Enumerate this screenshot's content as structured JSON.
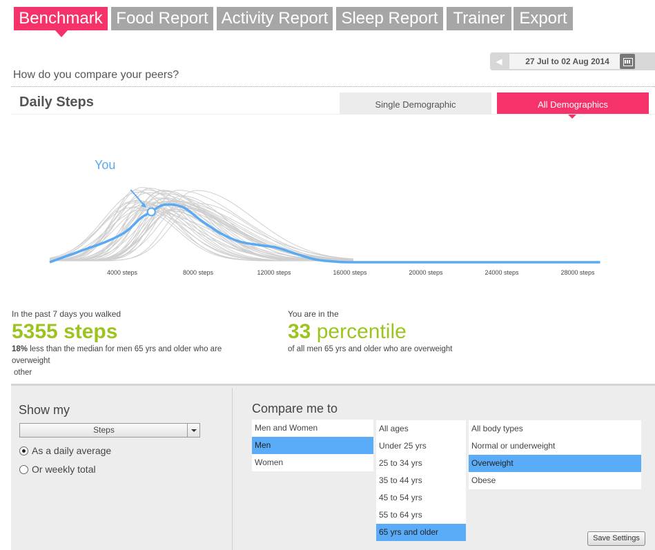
{
  "tabs": [
    {
      "label": "Benchmark",
      "active": true
    },
    {
      "label": "Food Report",
      "active": false
    },
    {
      "label": "Activity Report",
      "active": false
    },
    {
      "label": "Sleep Report",
      "active": false
    },
    {
      "label": "Trainer",
      "active": false
    },
    {
      "label": "Export",
      "active": false
    }
  ],
  "date_range": "27 Jul to 02 Aug 2014",
  "subtitle": "How do you compare your peers?",
  "section_title": "Daily Steps",
  "view_toggle": {
    "single": "Single Demographic",
    "all": "All Demographics",
    "selected": "all"
  },
  "you_label": "You",
  "colors": {
    "accent": "#f5336a",
    "highlight": "#5aabf8",
    "green": "#9dc31f",
    "tab_gray": "#a6a6a6"
  },
  "chart_data": {
    "type": "line",
    "x_ticks": [
      "4000 steps",
      "8000 steps",
      "12000 steps",
      "16000 steps",
      "20000 steps",
      "24000 steps",
      "28000 steps"
    ],
    "series": [
      {
        "name": "You",
        "x": [
          0,
          2000,
          3000,
          4000,
          4800,
          5355,
          6000,
          7000,
          8000,
          9000,
          10000,
          11000,
          12000,
          13000,
          14000,
          15000,
          16000,
          20000,
          24000,
          28000,
          29000
        ],
        "y": [
          0.0,
          0.2,
          0.3,
          0.44,
          0.64,
          0.73,
          0.83,
          0.8,
          0.6,
          0.42,
          0.3,
          0.25,
          0.21,
          0.12,
          0.04,
          0.01,
          0.0,
          0.0,
          0.0,
          0.0,
          0.0
        ]
      }
    ],
    "you_marker_x": 5355,
    "grid": false
  },
  "stats": {
    "steps_lead": "In the past 7 days you walked",
    "steps_value": "5355 steps",
    "steps_pct": "18%",
    "steps_desc": "less than the median for men 65 yrs and older who are overweight",
    "steps_other": "other",
    "pct_lead": "You are in the",
    "pct_number": "33",
    "pct_word": "percentile",
    "pct_desc": "of all men 65 yrs and older who are overweight"
  },
  "show_my": {
    "label": "Show my",
    "select_value": "Steps",
    "options": [
      "As a daily average",
      "Or weekly total"
    ],
    "selected": 0
  },
  "compare": {
    "label": "Compare me to",
    "genders": [
      "Men and Women",
      "Men",
      "Women"
    ],
    "gender_selected": 1,
    "ages": [
      "All ages",
      "Under 25 yrs",
      "25 to 34 yrs",
      "35 to 44 yrs",
      "45 to 54 yrs",
      "55 to 64 yrs",
      "65 yrs and older"
    ],
    "age_selected": 6,
    "bodies": [
      "All body types",
      "Normal or underweight",
      "Overweight",
      "Obese"
    ],
    "body_selected": 2
  },
  "save_label": "Save Settings"
}
